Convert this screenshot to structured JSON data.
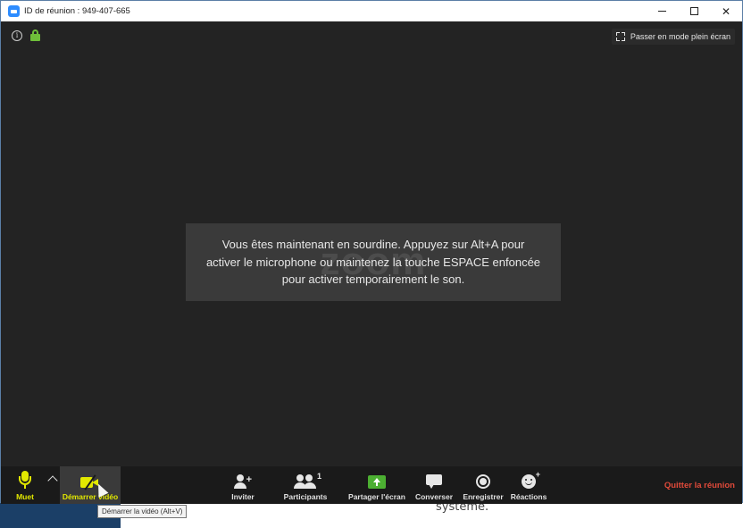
{
  "window": {
    "title": "ID de réunion : 949-407-665",
    "controls": {
      "minimize": "minimize",
      "maximize": "maximize",
      "close": "✕"
    }
  },
  "meeting": {
    "fullscreen_label": "Passer en mode plein écran",
    "watermark": "zoom",
    "mute_notice": "Vous êtes maintenant en sourdine. Appuyez sur Alt+A pour activer le microphone ou maintenez la touche ESPACE enfoncée pour activer temporairement le son."
  },
  "toolbar": {
    "mute_label": "Muet",
    "video_label": "Démarrer vidéo",
    "video_tooltip": "Démarrer la vidéo (Alt+V)",
    "invite_label": "Inviter",
    "participants_label": "Participants",
    "participants_count": "1",
    "share_label": "Partager l'écran",
    "chat_label": "Converser",
    "record_label": "Enregistrer",
    "reactions_label": "Réactions",
    "leave_label": "Quitter la réunion"
  },
  "background": {
    "text": "système."
  },
  "colors": {
    "accent_yellow": "#e2e800",
    "share_green": "#4caf32",
    "leave_red": "#e04a3a",
    "lock_green": "#6fbf3a"
  }
}
